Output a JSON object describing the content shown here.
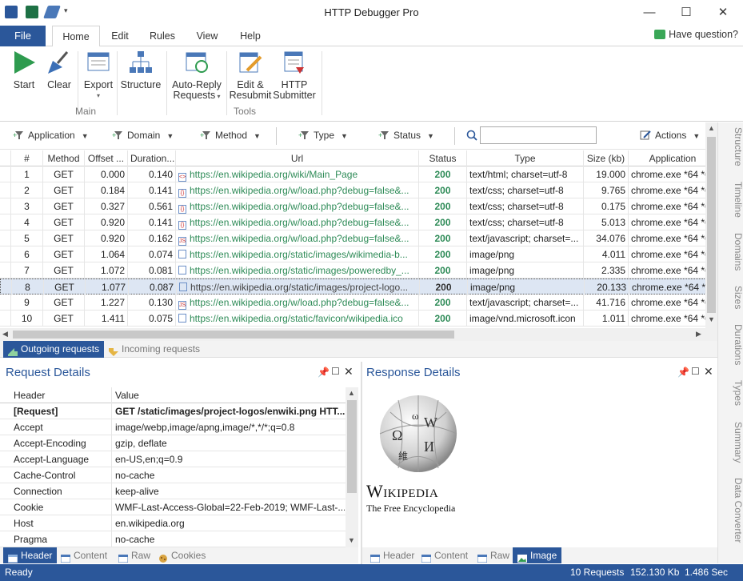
{
  "window": {
    "title": "HTTP Debugger Pro",
    "minimize_icon": "minimize-icon",
    "maximize_icon": "maximize-icon",
    "close_icon": "close-icon"
  },
  "ribbon_tabs": {
    "file": "File",
    "home": "Home",
    "edit": "Edit",
    "rules": "Rules",
    "view": "View",
    "help": "Help",
    "question": "Have question?"
  },
  "ribbon": {
    "start": "Start",
    "clear": "Clear",
    "export": "Export",
    "structure": "Structure",
    "auto_reply_line1": "Auto-Reply",
    "auto_reply_line2": "Requests",
    "edit_resubmit_line1": "Edit &",
    "edit_resubmit_line2": "Resubmit",
    "http_submitter_line1": "HTTP",
    "http_submitter_line2": "Submitter",
    "group_main": "Main",
    "group_tools": "Tools"
  },
  "filters": {
    "application": "Application",
    "domain": "Domain",
    "method": "Method",
    "type": "Type",
    "status": "Status",
    "search_value": "",
    "actions": "Actions"
  },
  "grid": {
    "columns": [
      "#",
      "Method",
      "Offset ...",
      "Duration...",
      "Url",
      "Status",
      "Type",
      "Size (kb)",
      "Application"
    ],
    "rows": [
      {
        "n": "1",
        "method": "GET",
        "offset": "0.000",
        "duration": "0.140",
        "url": "https://en.wikipedia.org/wiki/Main_Page",
        "status": "200",
        "type": "text/html; charset=utf-8",
        "size": "19.000",
        "app": "chrome.exe *64 *6"
      },
      {
        "n": "2",
        "method": "GET",
        "offset": "0.184",
        "duration": "0.141",
        "url": "https://en.wikipedia.org/w/load.php?debug=false&...",
        "status": "200",
        "type": "text/css; charset=utf-8",
        "size": "9.765",
        "app": "chrome.exe *64 *6"
      },
      {
        "n": "3",
        "method": "GET",
        "offset": "0.327",
        "duration": "0.561",
        "url": "https://en.wikipedia.org/w/load.php?debug=false&...",
        "status": "200",
        "type": "text/css; charset=utf-8",
        "size": "0.175",
        "app": "chrome.exe *64 *6"
      },
      {
        "n": "4",
        "method": "GET",
        "offset": "0.920",
        "duration": "0.141",
        "url": "https://en.wikipedia.org/w/load.php?debug=false&...",
        "status": "200",
        "type": "text/css; charset=utf-8",
        "size": "5.013",
        "app": "chrome.exe *64 *6"
      },
      {
        "n": "5",
        "method": "GET",
        "offset": "0.920",
        "duration": "0.162",
        "url": "https://en.wikipedia.org/w/load.php?debug=false&...",
        "status": "200",
        "type": "text/javascript; charset=...",
        "size": "34.076",
        "app": "chrome.exe *64 *6"
      },
      {
        "n": "6",
        "method": "GET",
        "offset": "1.064",
        "duration": "0.074",
        "url": "https://en.wikipedia.org/static/images/wikimedia-b...",
        "status": "200",
        "type": "image/png",
        "size": "4.011",
        "app": "chrome.exe *64 *6"
      },
      {
        "n": "7",
        "method": "GET",
        "offset": "1.072",
        "duration": "0.081",
        "url": "https://en.wikipedia.org/static/images/poweredby_...",
        "status": "200",
        "type": "image/png",
        "size": "2.335",
        "app": "chrome.exe *64 *6"
      },
      {
        "n": "8",
        "method": "GET",
        "offset": "1.077",
        "duration": "0.087",
        "url": "https://en.wikipedia.org/static/images/project-logo...",
        "status": "200",
        "type": "image/png",
        "size": "20.133",
        "app": "chrome.exe *64 *6"
      },
      {
        "n": "9",
        "method": "GET",
        "offset": "1.227",
        "duration": "0.130",
        "url": "https://en.wikipedia.org/w/load.php?debug=false&...",
        "status": "200",
        "type": "text/javascript; charset=...",
        "size": "41.716",
        "app": "chrome.exe *64 *6"
      },
      {
        "n": "10",
        "method": "GET",
        "offset": "1.411",
        "duration": "0.075",
        "url": "https://en.wikipedia.org/static/favicon/wikipedia.ico",
        "status": "200",
        "type": "image/vnd.microsoft.icon",
        "size": "1.011",
        "app": "chrome.exe *64 *6"
      }
    ],
    "selected_row": 8
  },
  "request_tabs": {
    "outgoing": "Outgoing requests",
    "incoming": "Incoming requests"
  },
  "side_tabs": [
    "Structure",
    "Timeline",
    "Domains",
    "Sizes",
    "Durations",
    "Types",
    "Summary",
    "Data Converter"
  ],
  "request_details": {
    "title": "Request Details",
    "col_header": "Header",
    "col_value": "Value",
    "rows": [
      {
        "k": "[Request]",
        "v": "GET /static/images/project-logos/enwiki.png HTT...",
        "bold": true
      },
      {
        "k": "Accept",
        "v": "image/webp,image/apng,image/*,*/*;q=0.8"
      },
      {
        "k": "Accept-Encoding",
        "v": "gzip, deflate"
      },
      {
        "k": "Accept-Language",
        "v": "en-US,en;q=0.9"
      },
      {
        "k": "Cache-Control",
        "v": "no-cache"
      },
      {
        "k": "Connection",
        "v": "keep-alive"
      },
      {
        "k": "Cookie",
        "v": "WMF-Last-Access-Global=22-Feb-2019; WMF-Last-..."
      },
      {
        "k": "Host",
        "v": "en.wikipedia.org"
      },
      {
        "k": "Pragma",
        "v": "no-cache"
      }
    ],
    "tabs": [
      "Header",
      "Content",
      "Raw",
      "Cookies"
    ]
  },
  "response_details": {
    "title": "Response Details",
    "logo_wordmark": "Wikipedia",
    "logo_tagline": "The Free Encyclopedia",
    "tabs": [
      "Header",
      "Content",
      "Raw",
      "Image"
    ]
  },
  "statusbar": {
    "ready": "Ready",
    "requests": "10 Requests",
    "size": "152.130 Kb",
    "time": "1.486 Sec"
  },
  "colors": {
    "accent": "#2b579a",
    "status_ok": "#2e8b57"
  }
}
